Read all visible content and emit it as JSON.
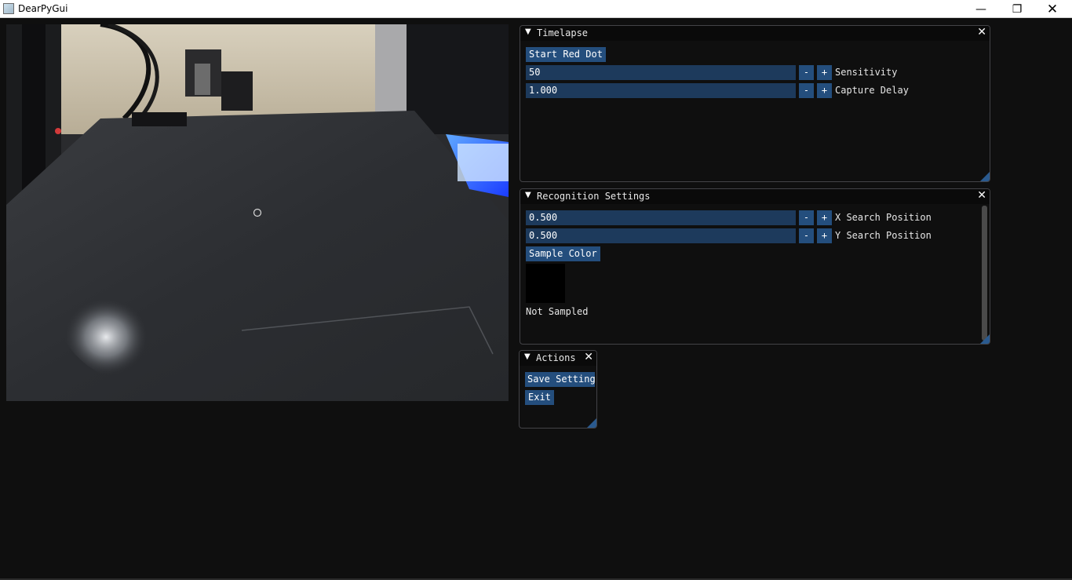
{
  "window": {
    "title": "DearPyGui",
    "minimize_glyph": "—",
    "maximize_glyph": "❐",
    "close_glyph": "✕"
  },
  "camera": {
    "description_icon": "camera-preview"
  },
  "timelapse": {
    "title": "Timelapse",
    "collapse_glyph": "▼",
    "close_glyph": "✕",
    "start_button": "Start Red Dot",
    "sensitivity": {
      "value": "50",
      "label": "Sensitivity"
    },
    "capture_delay": {
      "value": "1.000",
      "label": "Capture Delay"
    },
    "minus": "-",
    "plus": "+"
  },
  "recognition": {
    "title": "Recognition Settings",
    "collapse_glyph": "▼",
    "close_glyph": "✕",
    "x_search": {
      "value": "0.500",
      "label": "X Search Position"
    },
    "y_search": {
      "value": "0.500",
      "label": "Y Search Position"
    },
    "sample_button": "Sample Color",
    "sample_status": "Not Sampled",
    "minus": "-",
    "plus": "+"
  },
  "actions": {
    "title": "Actions",
    "collapse_glyph": "▼",
    "close_glyph": "✕",
    "save_button": "Save Setting",
    "exit_button": "Exit"
  },
  "colors": {
    "button": "#244e7d",
    "field": "#1d3a5c",
    "background": "#0f0f0f",
    "swatch": "#000000"
  }
}
